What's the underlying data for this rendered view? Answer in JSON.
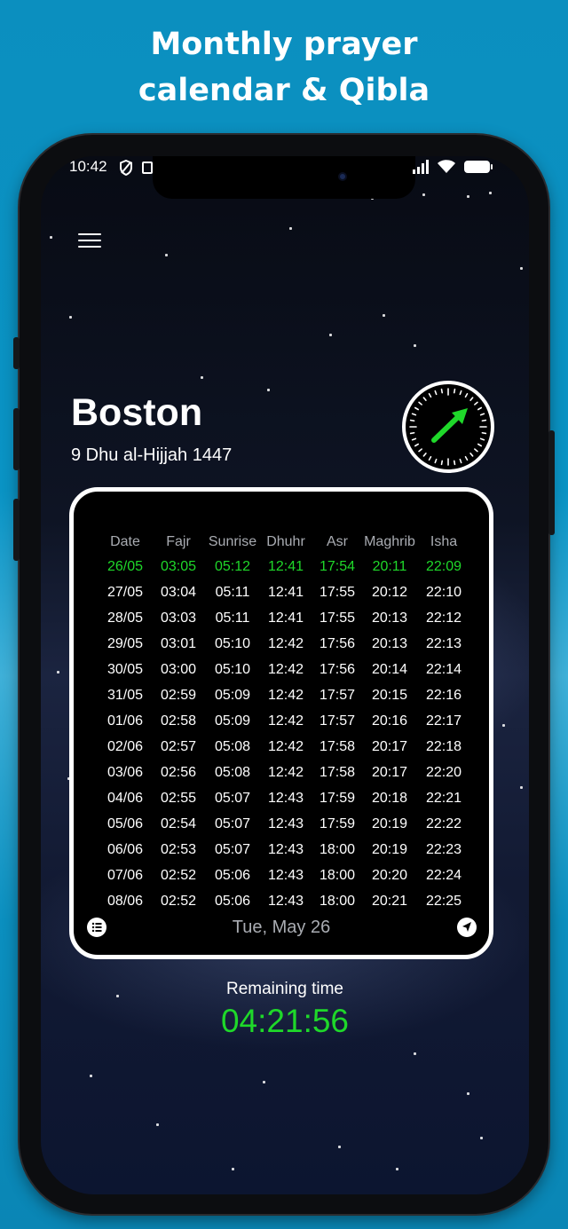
{
  "promo": {
    "line1": "Monthly prayer",
    "line2": "calendar & Qibla"
  },
  "status_bar": {
    "time": "10:42",
    "icons": [
      "shield-icon",
      "screen-icon",
      "signal-icon",
      "wifi-icon",
      "battery-icon"
    ]
  },
  "header": {
    "menu_icon": "hamburger-menu-icon",
    "city": "Boston",
    "hijri_date": "9 Dhu al-Hijjah 1447",
    "qibla_icon": "qibla-compass-icon"
  },
  "colors": {
    "accent_green": "#1fd82a",
    "header_gray": "#a9acb2",
    "background_blue": "#0b8fbf"
  },
  "table": {
    "headers": [
      "Date",
      "Fajr",
      "Sunrise",
      "Dhuhr",
      "Asr",
      "Maghrib",
      "Isha"
    ],
    "rows": [
      [
        "26/05",
        "03:05",
        "05:12",
        "12:41",
        "17:54",
        "20:11",
        "22:09"
      ],
      [
        "27/05",
        "03:04",
        "05:11",
        "12:41",
        "17:55",
        "20:12",
        "22:10"
      ],
      [
        "28/05",
        "03:03",
        "05:11",
        "12:41",
        "17:55",
        "20:13",
        "22:12"
      ],
      [
        "29/05",
        "03:01",
        "05:10",
        "12:42",
        "17:56",
        "20:13",
        "22:13"
      ],
      [
        "30/05",
        "03:00",
        "05:10",
        "12:42",
        "17:56",
        "20:14",
        "22:14"
      ],
      [
        "31/05",
        "02:59",
        "05:09",
        "12:42",
        "17:57",
        "20:15",
        "22:16"
      ],
      [
        "01/06",
        "02:58",
        "05:09",
        "12:42",
        "17:57",
        "20:16",
        "22:17"
      ],
      [
        "02/06",
        "02:57",
        "05:08",
        "12:42",
        "17:58",
        "20:17",
        "22:18"
      ],
      [
        "03/06",
        "02:56",
        "05:08",
        "12:42",
        "17:58",
        "20:17",
        "22:20"
      ],
      [
        "04/06",
        "02:55",
        "05:07",
        "12:43",
        "17:59",
        "20:18",
        "22:21"
      ],
      [
        "05/06",
        "02:54",
        "05:07",
        "12:43",
        "17:59",
        "20:19",
        "22:22"
      ],
      [
        "06/06",
        "02:53",
        "05:07",
        "12:43",
        "18:00",
        "20:19",
        "22:23"
      ],
      [
        "07/06",
        "02:52",
        "05:06",
        "12:43",
        "18:00",
        "20:20",
        "22:24"
      ],
      [
        "08/06",
        "02:52",
        "05:06",
        "12:43",
        "18:00",
        "20:21",
        "22:25"
      ]
    ],
    "current_date": "Tue, May 26",
    "list_icon": "list-icon",
    "location_icon": "navigation-arrow-icon"
  },
  "countdown": {
    "label": "Remaining time",
    "value": "04:21:56"
  }
}
